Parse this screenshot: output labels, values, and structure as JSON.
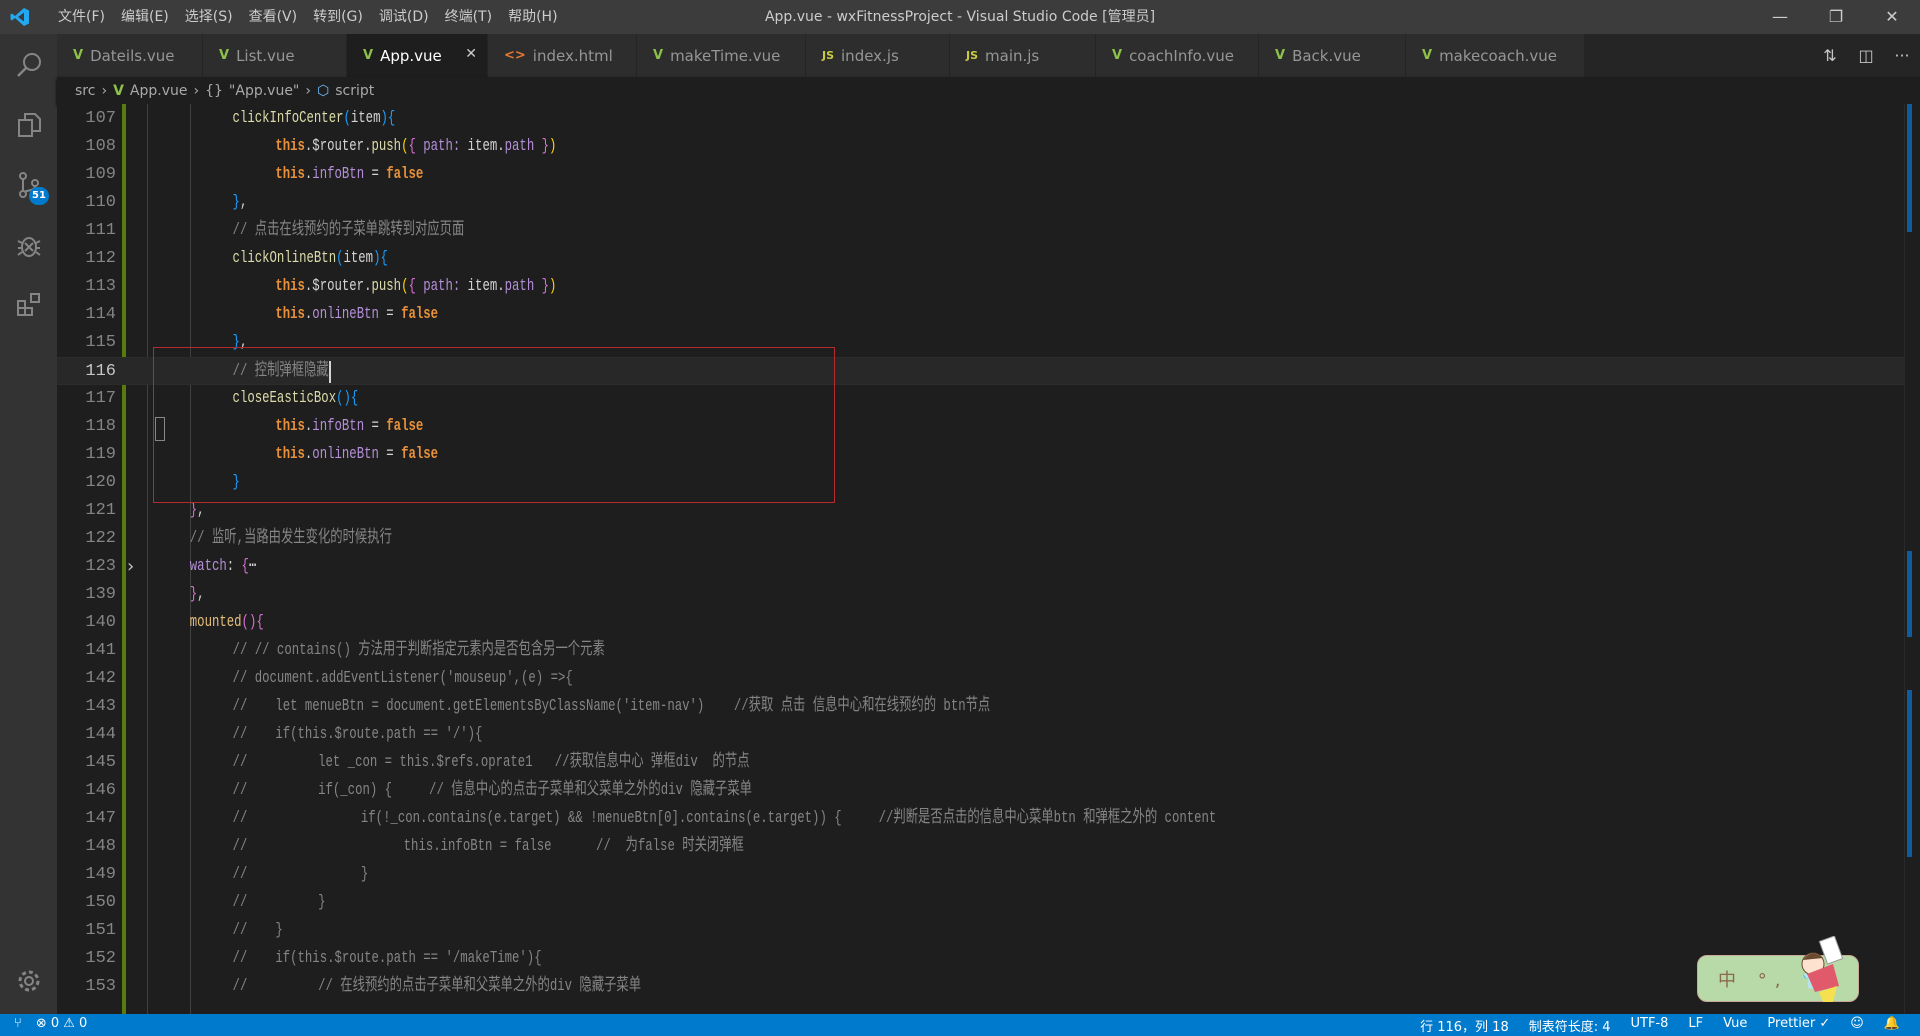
{
  "window": {
    "title": "App.vue - wxFitnessProject - Visual Studio Code [管理员]"
  },
  "menu": [
    "文件(F)",
    "编辑(E)",
    "选择(S)",
    "查看(V)",
    "转到(G)",
    "调试(D)",
    "终端(T)",
    "帮助(H)"
  ],
  "activity": {
    "scm_badge": "51"
  },
  "tabs": [
    {
      "label": "Dateils.vue",
      "icon": "vue"
    },
    {
      "label": "List.vue",
      "icon": "vue"
    },
    {
      "label": "App.vue",
      "icon": "vue",
      "active": true
    },
    {
      "label": "index.html",
      "icon": "html"
    },
    {
      "label": "makeTime.vue",
      "icon": "vue"
    },
    {
      "label": "index.js",
      "icon": "js"
    },
    {
      "label": "main.js",
      "icon": "js"
    },
    {
      "label": "coachInfo.vue",
      "icon": "vue"
    },
    {
      "label": "Back.vue",
      "icon": "vue"
    },
    {
      "label": "makecoach.vue",
      "icon": "vue"
    }
  ],
  "breadcrumb": {
    "folder": "src",
    "file": "App.vue",
    "object": "\"App.vue\"",
    "symbol": "script"
  },
  "editor": {
    "current_line": 116,
    "lines": [
      {
        "n": "107",
        "t": [
          [
            "pl",
            "\t\t"
          ],
          [
            "fn",
            "clickInfoCenter"
          ],
          [
            "b3",
            "("
          ],
          [
            "pl",
            "item"
          ],
          [
            "b3",
            ")"
          ],
          [
            "b3",
            "{"
          ]
        ]
      },
      {
        "n": "108",
        "t": [
          [
            "pl",
            "\t\t\t"
          ],
          [
            "kw",
            "this"
          ],
          [
            "pl",
            ".$router."
          ],
          [
            "fn",
            "push"
          ],
          [
            "b1",
            "("
          ],
          [
            "b2",
            "{"
          ],
          [
            "prop",
            " path:"
          ],
          [
            "pl",
            " item."
          ],
          [
            "prop",
            "path"
          ],
          [
            "b2",
            " }"
          ],
          [
            "b1",
            ")"
          ]
        ]
      },
      {
        "n": "109",
        "t": [
          [
            "pl",
            "\t\t\t"
          ],
          [
            "kw",
            "this"
          ],
          [
            "pl",
            "."
          ],
          [
            "prop",
            "infoBtn"
          ],
          [
            "pl",
            " = "
          ],
          [
            "kw",
            "false"
          ]
        ]
      },
      {
        "n": "110",
        "t": [
          [
            "pl",
            "\t\t"
          ],
          [
            "b3",
            "}"
          ],
          [
            "pl",
            ","
          ]
        ]
      },
      {
        "n": "111",
        "t": [
          [
            "pl",
            "\t\t"
          ],
          [
            "cm",
            "// 点击在线预约的子菜单跳转到对应页面"
          ]
        ]
      },
      {
        "n": "112",
        "t": [
          [
            "pl",
            "\t\t"
          ],
          [
            "fn",
            "clickOnlineBtn"
          ],
          [
            "b3",
            "("
          ],
          [
            "pl",
            "item"
          ],
          [
            "b3",
            ")"
          ],
          [
            "b3",
            "{"
          ]
        ]
      },
      {
        "n": "113",
        "t": [
          [
            "pl",
            "\t\t\t"
          ],
          [
            "kw",
            "this"
          ],
          [
            "pl",
            ".$router."
          ],
          [
            "fn",
            "push"
          ],
          [
            "b1",
            "("
          ],
          [
            "b2",
            "{"
          ],
          [
            "prop",
            " path:"
          ],
          [
            "pl",
            " item."
          ],
          [
            "prop",
            "path"
          ],
          [
            "b2",
            " }"
          ],
          [
            "b1",
            ")"
          ]
        ]
      },
      {
        "n": "114",
        "t": [
          [
            "pl",
            "\t\t\t"
          ],
          [
            "kw",
            "this"
          ],
          [
            "pl",
            "."
          ],
          [
            "prop",
            "onlineBtn"
          ],
          [
            "pl",
            " = "
          ],
          [
            "kw",
            "false"
          ]
        ]
      },
      {
        "n": "115",
        "t": [
          [
            "pl",
            "\t\t"
          ],
          [
            "b3",
            "}"
          ],
          [
            "pl",
            ","
          ]
        ]
      },
      {
        "n": "116",
        "t": [
          [
            "pl",
            "\t\t"
          ],
          [
            "cm",
            "// 控制弹框隐藏"
          ]
        ]
      },
      {
        "n": "117",
        "t": [
          [
            "pl",
            "\t\t"
          ],
          [
            "fn",
            "closeEasticBox"
          ],
          [
            "b3",
            "()"
          ],
          [
            "b3",
            "{"
          ]
        ]
      },
      {
        "n": "118",
        "t": [
          [
            "pl",
            "\t\t\t"
          ],
          [
            "kw",
            "this"
          ],
          [
            "pl",
            "."
          ],
          [
            "prop",
            "infoBtn"
          ],
          [
            "pl",
            " = "
          ],
          [
            "kw",
            "false"
          ]
        ]
      },
      {
        "n": "119",
        "t": [
          [
            "pl",
            "\t\t\t"
          ],
          [
            "kw",
            "this"
          ],
          [
            "pl",
            "."
          ],
          [
            "prop",
            "onlineBtn"
          ],
          [
            "pl",
            " = "
          ],
          [
            "kw",
            "false"
          ]
        ]
      },
      {
        "n": "120",
        "t": [
          [
            "pl",
            "\t\t"
          ],
          [
            "b3",
            "}"
          ]
        ]
      },
      {
        "n": "121",
        "t": [
          [
            "pl",
            "\t"
          ],
          [
            "b2",
            "}"
          ],
          [
            "pl",
            ","
          ]
        ]
      },
      {
        "n": "122",
        "t": [
          [
            "pl",
            "\t"
          ],
          [
            "cm",
            "// 监听,当路由发生变化的时候执行"
          ]
        ]
      },
      {
        "n": "123",
        "fold": true,
        "t": [
          [
            "pl",
            "\t"
          ],
          [
            "prop",
            "watch"
          ],
          [
            "pl",
            ": "
          ],
          [
            "b2",
            "{"
          ],
          [
            "pl",
            "⋯"
          ]
        ]
      },
      {
        "n": "139",
        "t": [
          [
            "pl",
            "\t"
          ],
          [
            "b2",
            "}"
          ],
          [
            "pl",
            ","
          ]
        ]
      },
      {
        "n": "140",
        "t": [
          [
            "pl",
            "\t"
          ],
          [
            "mt",
            "mounted"
          ],
          [
            "b2",
            "()"
          ],
          [
            "b2",
            "{"
          ]
        ]
      },
      {
        "n": "141",
        "t": [
          [
            "pl",
            "\t\t"
          ],
          [
            "cm",
            "// // contains() 方法用于判断指定元素内是否包含另一个元素"
          ]
        ]
      },
      {
        "n": "142",
        "t": [
          [
            "pl",
            "\t\t"
          ],
          [
            "cm",
            "// document.addEventListener('mouseup',(e) =>{"
          ]
        ]
      },
      {
        "n": "143",
        "t": [
          [
            "pl",
            "\t\t"
          ],
          [
            "cm",
            "//\tlet menueBtn = document.getElementsByClassName('item-nav')    //获取 点击 信息中心和在线预约的 btn节点"
          ]
        ]
      },
      {
        "n": "144",
        "t": [
          [
            "pl",
            "\t\t"
          ],
          [
            "cm",
            "//\tif(this.$route.path == '/'){"
          ]
        ]
      },
      {
        "n": "145",
        "t": [
          [
            "pl",
            "\t\t"
          ],
          [
            "cm",
            "//\t\tlet _con = this.$refs.oprate1   //获取信息中心 弹框div  的节点"
          ]
        ]
      },
      {
        "n": "146",
        "t": [
          [
            "pl",
            "\t\t"
          ],
          [
            "cm",
            "//\t\tif(_con) {     // 信息中心的点击子菜单和父菜单之外的div 隐藏子菜单"
          ]
        ]
      },
      {
        "n": "147",
        "t": [
          [
            "pl",
            "\t\t"
          ],
          [
            "cm",
            "//\t\t\tif(!_con.contains(e.target) && !menueBtn[0].contains(e.target)) {     //判断是否点击的信息中心菜单btn 和弹框之外的 content"
          ]
        ]
      },
      {
        "n": "148",
        "t": [
          [
            "pl",
            "\t\t"
          ],
          [
            "cm",
            "//\t\t\t\tthis.infoBtn = false      //  为false 时关闭弹框"
          ]
        ]
      },
      {
        "n": "149",
        "t": [
          [
            "pl",
            "\t\t"
          ],
          [
            "cm",
            "//\t\t\t}"
          ]
        ]
      },
      {
        "n": "150",
        "t": [
          [
            "pl",
            "\t\t"
          ],
          [
            "cm",
            "//\t\t}"
          ]
        ]
      },
      {
        "n": "151",
        "t": [
          [
            "pl",
            "\t\t"
          ],
          [
            "cm",
            "//\t}"
          ]
        ]
      },
      {
        "n": "152",
        "t": [
          [
            "pl",
            "\t\t"
          ],
          [
            "cm",
            "//\tif(this.$route.path == '/makeTime'){"
          ]
        ]
      },
      {
        "n": "153",
        "t": [
          [
            "pl",
            "\t\t"
          ],
          [
            "cm",
            "//\t\t// 在线预约的点击子菜单和父菜单之外的div 隐藏子菜单"
          ]
        ]
      }
    ]
  },
  "ime": {
    "text": "中 °, 👕"
  },
  "statusbar": {
    "problems": "⊗ 0 ⚠ 0",
    "position": "行 116，列 18",
    "tab_size": "制表符长度: 4",
    "encoding": "UTF-8",
    "eol": "LF",
    "language": "Vue",
    "prettier": "Prettier ✓"
  },
  "colors": {
    "accent": "#007acc",
    "highlight_box": "#b52a2a",
    "git_modified": "#587c0c"
  }
}
